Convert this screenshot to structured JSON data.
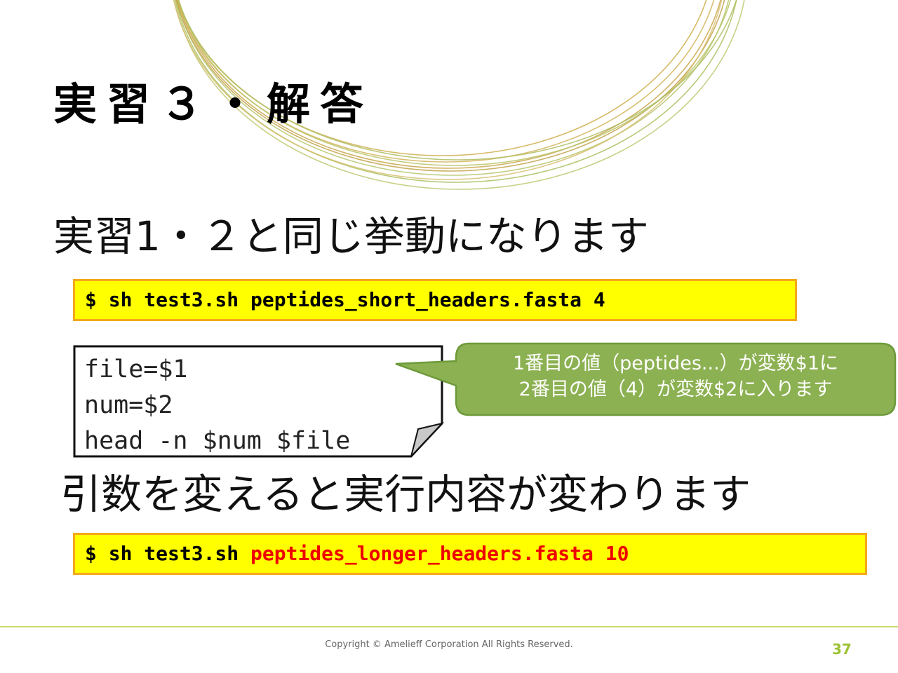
{
  "slide": {
    "title": "実習３・解答",
    "heading1": "実習1・２と同じ挙動になります",
    "command1": "$ sh test3.sh peptides_short_headers.fasta 4",
    "code_lines": [
      "file=$1",
      "num=$2",
      "head -n $num $file"
    ],
    "callout": {
      "line1": "1番目の値（peptides...）が変数$1に",
      "line2": "2番目の値（4）が変数$2に入ります"
    },
    "heading2": "引数を変えると実行内容が変わります",
    "command2": {
      "prefix": "$ sh test3.sh ",
      "highlight": "peptides_longer_headers.fasta 10"
    },
    "footer": {
      "copyright": "Copyright © Amelieff Corporation All Rights Reserved.",
      "page_number": "37"
    }
  },
  "colors": {
    "command_bg": "#ffff00",
    "command_border": "#f3a81a",
    "highlight_text": "#ee0000",
    "callout_fill": "#8cb152",
    "callout_border": "#6d9a3a",
    "accent": "#9cc234"
  },
  "decoration": {
    "name": "concentric-circles-ornament"
  }
}
